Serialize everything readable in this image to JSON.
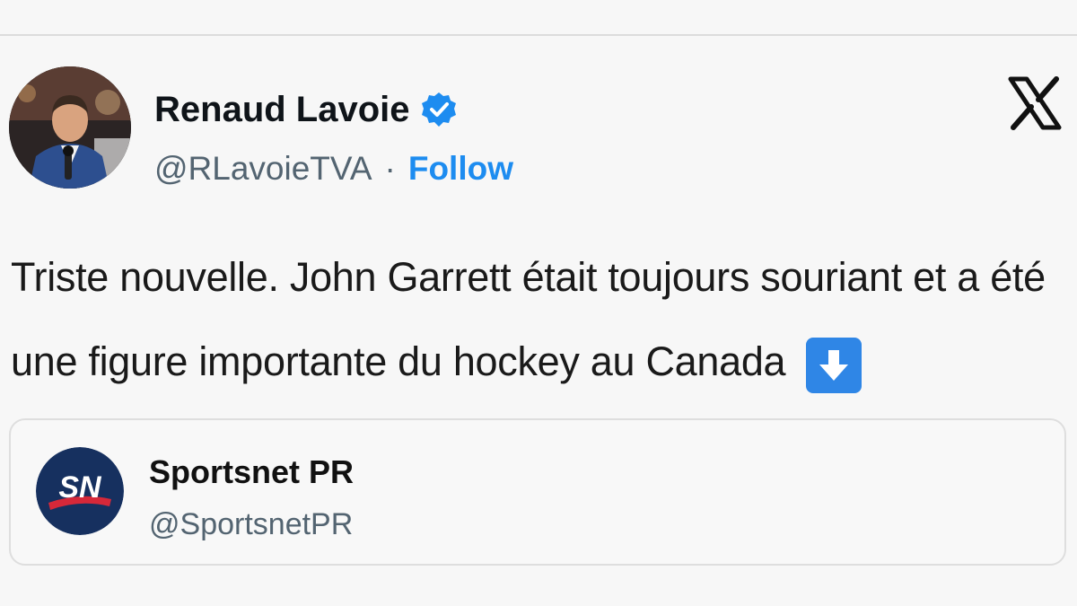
{
  "author": {
    "name": "Renaud Lavoie",
    "handle": "@RLavoieTVA",
    "separator": "·",
    "follow_label": "Follow",
    "verified_icon": "verified-badge-icon",
    "avatar": "avatar-photo"
  },
  "platform_logo": "x-logo-icon",
  "tweet": {
    "text": "Triste nouvelle. John Garrett était toujours souriant et a été une figure importante du hockey au Canada",
    "emoji": "down-arrow-emoji-icon"
  },
  "quoted": {
    "logo_text": "SN",
    "name": "Sportsnet PR",
    "handle": "@SportsnetPR"
  },
  "colors": {
    "accent": "#1d8cf0",
    "text": "#0f1419",
    "secondary": "#536471",
    "sn_navy": "#16305f"
  }
}
